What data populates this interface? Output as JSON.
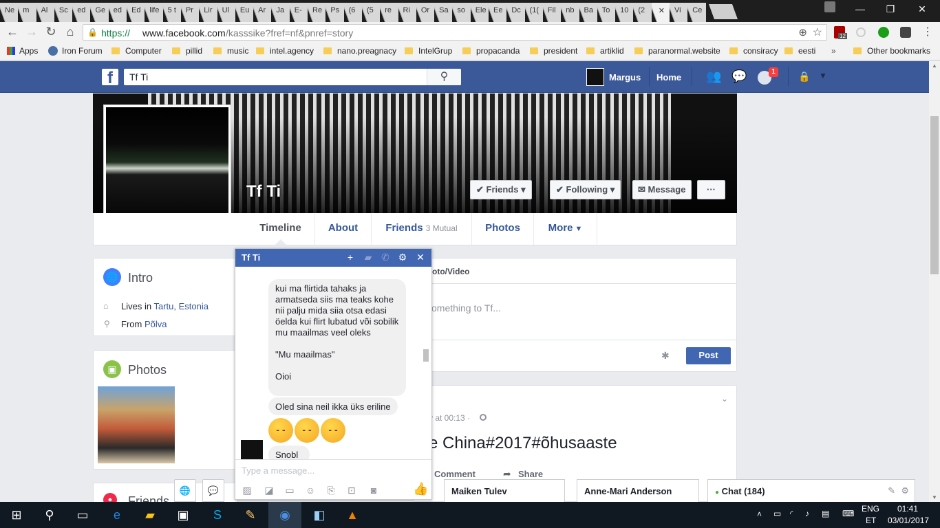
{
  "browser": {
    "tabs": [
      "Ne",
      "m",
      "Al",
      "Sc",
      "ed",
      "Ge",
      "ed",
      "Ed",
      "life",
      "5 t",
      "Pr",
      "Lir",
      "Ul",
      "Eu",
      "Ar",
      "Ja",
      "E-",
      "Re",
      "Ps",
      "(6",
      "(5",
      "re",
      "Ri",
      "Or",
      "Sa",
      "so",
      "Ele",
      "Ee",
      "Dc",
      "(1(",
      "Fil",
      "nb",
      "Ba",
      "To",
      "10",
      "(2",
      "",
      "Vi",
      "Ce"
    ],
    "active_tab_index": 36,
    "url_secure": "https://",
    "url_domain": "www.facebook.com",
    "url_path": "/kasssike?fref=nf&pnref=story",
    "extension_badge": "12"
  },
  "bookmarks": {
    "apps": "Apps",
    "items": [
      "Iron Forum",
      "Computer",
      "pillid",
      "music",
      "intel.agency",
      "nano.preagnacy",
      "IntelGrup",
      "propacanda",
      "president",
      "artiklid",
      "paranormal.website",
      "consiracy",
      "eesti"
    ],
    "more": "»",
    "other": "Other bookmarks"
  },
  "fb": {
    "search_value": "Tf Ti",
    "user_name": "Margus",
    "home": "Home",
    "notif_count": "1"
  },
  "profile": {
    "name": "Tf Ti",
    "btn_friends": "Friends",
    "btn_following": "Following",
    "btn_message": "Message",
    "btn_more": "···",
    "tabs": {
      "timeline": "Timeline",
      "about": "About",
      "friends": "Friends",
      "friends_sub": "3 Mutual",
      "photos": "Photos",
      "more": "More"
    }
  },
  "intro": {
    "title": "Intro",
    "lives_prefix": "Lives in ",
    "lives_city": "Tartu",
    "lives_sep": ", ",
    "lives_country": "Estonia",
    "from_prefix": "From ",
    "from_place": "Põlva"
  },
  "photos_card": {
    "title": "Photos"
  },
  "friends_card": {
    "title": "Friends"
  },
  "composer": {
    "tab": "oto/Video",
    "placeholder": "omething to Tf...",
    "post": "Post"
  },
  "post": {
    "time": "y at 00:13 ·",
    "text": "e China#2017#õhusaaste",
    "comment": "Comment",
    "share": "Share"
  },
  "chat": {
    "title": "Tf Ti",
    "messages": [
      "kui ma flirtida tahaks ja armatseda siis ma teaks kohe nii palju mida siia otsa edasi öelda kui flirt lubatud või sobilik mu maailmas veel oleks\n\n\"Mu maailmas\"\n\nOioi",
      "Oled sina neil ikka üks eriline",
      "Snobl"
    ],
    "emojis": [
      "😒",
      "😒",
      "😒"
    ],
    "input_placeholder": "Type a message..."
  },
  "bottom_chats": [
    "Maiken Tulev",
    "Anne-Mari Anderson"
  ],
  "chat_sidebar": "Chat (184)",
  "taskbar": {
    "lang1": "ENG",
    "lang2": "ET",
    "time": "01:41",
    "date": "03/01/2017"
  }
}
